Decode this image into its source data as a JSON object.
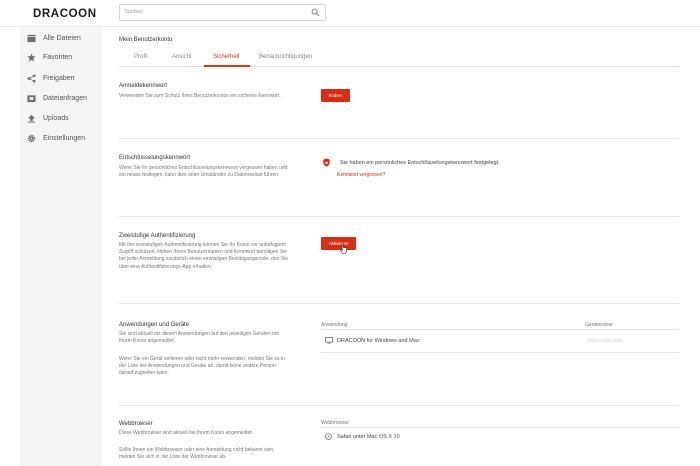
{
  "app": {
    "logo": "DRACOON"
  },
  "search": {
    "placeholder": "Suchen"
  },
  "sidebar": {
    "items": [
      {
        "label": "Alle Dateien",
        "icon": "folder-icon"
      },
      {
        "label": "Favoriten",
        "icon": "star-icon"
      },
      {
        "label": "Freigaben",
        "icon": "share-icon"
      },
      {
        "label": "Dateianfragen",
        "icon": "file-request-icon"
      },
      {
        "label": "Uploads",
        "icon": "upload-icon"
      },
      {
        "label": "Einstellungen",
        "icon": "gear-icon"
      }
    ]
  },
  "main": {
    "title": "Mein Benutzerkonto",
    "tabs": [
      {
        "label": "Profil"
      },
      {
        "label": "Ansicht"
      },
      {
        "label": "Sicherheit",
        "active": true
      },
      {
        "label": "Benachrichtigungen"
      }
    ]
  },
  "sections": {
    "login_password": {
      "title": "Anmeldekennwort",
      "desc": "Verwenden Sie zum Schutz Ihres Benutzerkontos ein sicheres Kennwort.",
      "button": "Ändern"
    },
    "encryption_password": {
      "title": "Entschlüsselungskennwort",
      "desc": "Wenn Sie Ihr persönliches Entschlüsselungskennwort vergessen haben und ein neues festlegen, kann dies unter Umständen zu Datenverlust führen.",
      "status": "Sie haben ein persönliches Entschlüsselungskennwort festgelegt.",
      "link": "Kennwort vergessen?"
    },
    "two_factor": {
      "title": "Zweistufige Authentifizierung",
      "desc": "Mit der zweistufigen Authentifizierung können Sie Ihr Konto vor unbefugtem Zugriff schützen. Neben Ihrem Benutzernamen und Kennwort benötigen Sie bei jeder Anmeldung zusätzlich einen einmaligen Bestätigungscode, den Sie über eine Authentifizierungs-App erhalten.",
      "button": "Aktivieren"
    },
    "apps_devices": {
      "title": "Anwendungen und Geräte",
      "desc1": "Sie sind aktuell mit diesen Anwendungen auf den jeweiligen Geräten mit Ihrem Konto angemeldet.",
      "desc2": "Wenn Sie ein Gerät verlieren oder nicht mehr verwenden, melden Sie es in der Liste der Anwendungen und Geräte ab, damit keine andere Person darauf zugreifen kann.",
      "col_app": "Anwendung",
      "col_device": "Gerätename",
      "rows": [
        {
          "app": "DRACOON for Windows and Mac",
          "device": "xxxxx-xxxx-xxxx"
        }
      ]
    },
    "browsers": {
      "title": "Webbrowser",
      "desc1": "Diese Webbrowser sind aktuell bei Ihrem Konto angemeldet.",
      "desc2": "Sollte Ihnen ein Webbrowser oder eine Anmeldung nicht bekannt sein, melden Sie sich in der Liste der Webbrowser ab.",
      "col_browser": "Webbrowser",
      "rows": [
        {
          "browser": "Safari unter Mac OS X 10"
        }
      ]
    }
  },
  "colors": {
    "accent": "#d42f14",
    "sidebar_bg": "#f5f5f5"
  }
}
